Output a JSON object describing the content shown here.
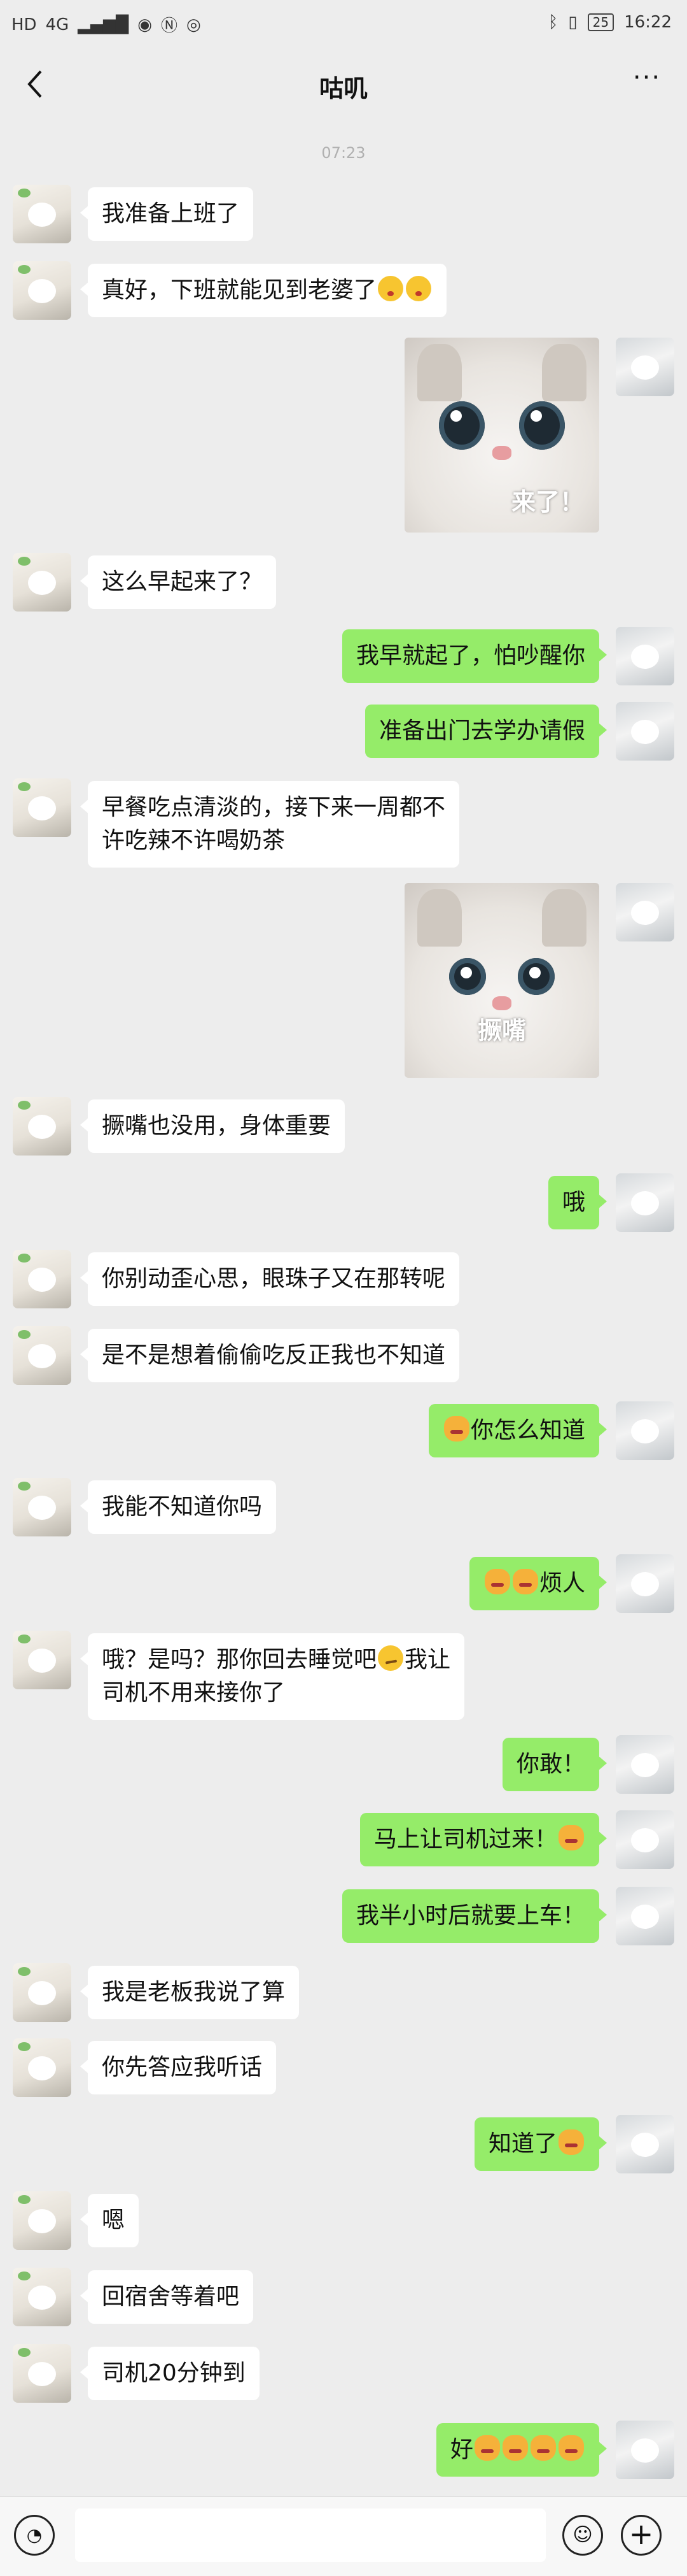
{
  "status_bar": {
    "left_icons": [
      "HD",
      "4G",
      "signal-icon",
      "eye-icon",
      "nfc-icon",
      "wechat-icon"
    ],
    "battery": "25",
    "time": "16:22"
  },
  "header": {
    "title": "咕叽",
    "more": "···"
  },
  "timestamp": "07:23",
  "messages": [
    {
      "side": "left",
      "text": "我准备上班了"
    },
    {
      "side": "left",
      "text": "真好，下班就能见到老婆了",
      "emoji": [
        "kiss-emoji",
        "kiss-emoji"
      ]
    },
    {
      "side": "right",
      "type": "image",
      "caption": "来了！"
    },
    {
      "side": "left",
      "text": "这么早起来了？"
    },
    {
      "side": "right",
      "text": "我早就起了，怕吵醒你"
    },
    {
      "side": "right",
      "text": "准备出门去学办请假"
    },
    {
      "side": "left",
      "text_line1": "早餐吃点清淡的，接下来一周都不",
      "text_line2": "许吃辣不许喝奶茶"
    },
    {
      "side": "right",
      "type": "image",
      "caption": "撅嘴"
    },
    {
      "side": "left",
      "text": "撅嘴也没用，身体重要"
    },
    {
      "side": "right",
      "text": "哦"
    },
    {
      "side": "left",
      "text": "你别动歪心思，眼珠子又在那转呢"
    },
    {
      "side": "left",
      "text": "是不是想着偷偷吃反正我也不知道"
    },
    {
      "side": "right",
      "text": "你怎么知道",
      "emoji_before": [
        "angry-cat-emoji"
      ]
    },
    {
      "side": "left",
      "text": "我能不知道你吗"
    },
    {
      "side": "right",
      "text": "烦人",
      "emoji_before": [
        "angry-cat-emoji",
        "angry-cat-emoji"
      ]
    },
    {
      "side": "left",
      "text_line1": "哦？是吗？那你回去睡觉吧",
      "text_line1b": "我让",
      "text_line2": "司机不用来接你了",
      "emoji": [
        "smirk-emoji"
      ]
    },
    {
      "side": "right",
      "text": "你敢！"
    },
    {
      "side": "right",
      "text": "马上让司机过来！",
      "emoji_after": [
        "angry-cat-emoji"
      ]
    },
    {
      "side": "right",
      "text": "我半小时后就要上车！"
    },
    {
      "side": "left",
      "text": "我是老板我说了算"
    },
    {
      "side": "left",
      "text": "你先答应我听话"
    },
    {
      "side": "right",
      "text": "知道了",
      "emoji_after": [
        "angry-cat-emoji"
      ]
    },
    {
      "side": "left",
      "text": "嗯"
    },
    {
      "side": "left",
      "text": "回宿舍等着吧"
    },
    {
      "side": "left",
      "text": "司机20分钟到"
    },
    {
      "side": "right",
      "text": "好",
      "emoji_after": [
        "angry-cat-emoji",
        "angry-cat-emoji",
        "angry-cat-emoji",
        "angry-cat-emoji"
      ]
    }
  ],
  "input_bar": {
    "voice_icon": "voice-icon",
    "emoji_icon": "emoji-icon",
    "plus_icon": "plus-icon"
  }
}
